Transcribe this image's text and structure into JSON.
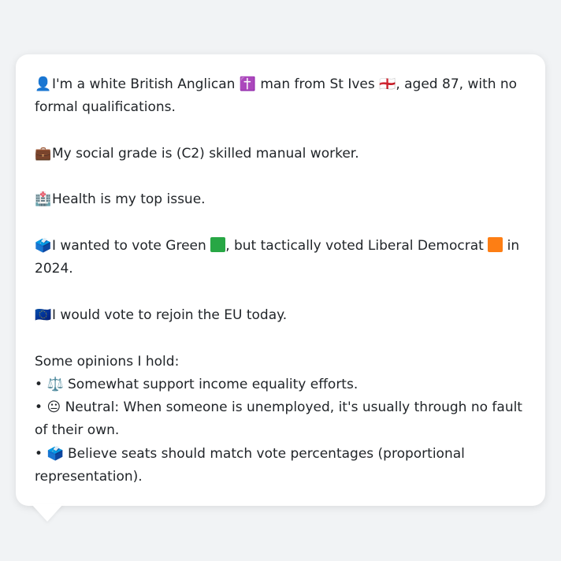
{
  "bio": {
    "identity": {
      "icon": "person-silhouette-icon",
      "text_a": "I'm a white British Anglican",
      "icon_religion": "latin-cross-icon",
      "text_b": "man from St Ives",
      "icon_flag": "england-flag-icon",
      "text_c": ", aged 87, with no formal qualifications."
    },
    "grade": {
      "icon": "briefcase-icon",
      "text": "My social grade is (C2) skilled manual worker."
    },
    "issue": {
      "icon": "hospital-icon",
      "text": "Health is my top issue."
    },
    "vote": {
      "icon": "ballot-box-icon",
      "text_a": "I wanted to vote Green",
      "green_color": "#28a745",
      "text_b": ", but tactically voted Liberal Democrat",
      "libdem_color": "#fd7e14",
      "text_c": "in 2024."
    },
    "eu": {
      "icon": "eu-flag-icon",
      "text": "I would vote to rejoin the EU today."
    }
  },
  "opinions": {
    "heading": "Some opinions I hold:",
    "items": [
      {
        "bullet": "•",
        "icon": "scales-icon",
        "text": "Somewhat support income equality efforts."
      },
      {
        "bullet": "•",
        "icon": "neutral-face-icon",
        "text": "Neutral: When someone is unemployed, it's usually through no fault of their own."
      },
      {
        "bullet": "•",
        "icon": "ballot-box-icon",
        "text": "Believe seats should match vote percentages (proportional representation)."
      }
    ]
  }
}
